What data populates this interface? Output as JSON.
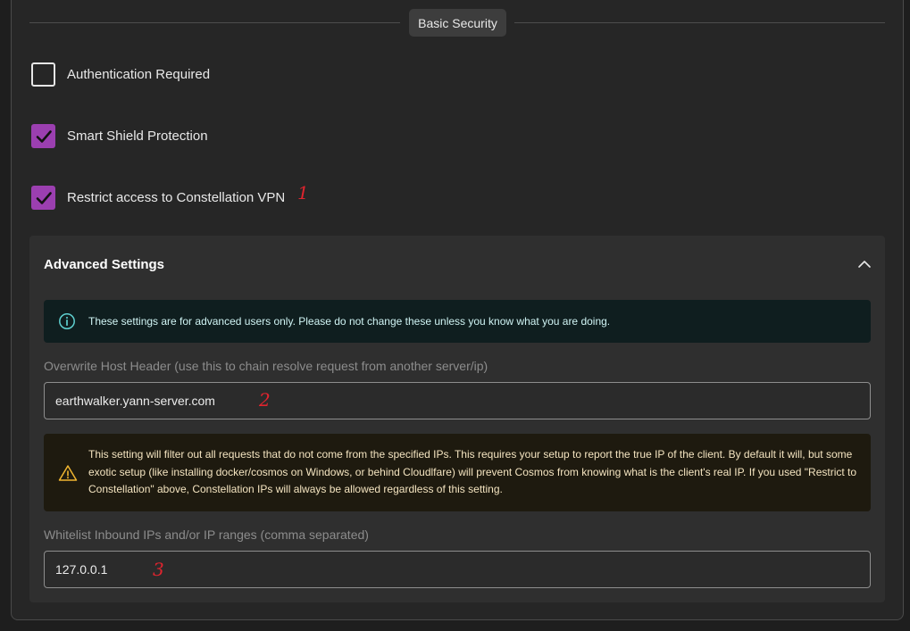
{
  "section": {
    "title": "Basic Security"
  },
  "checkboxes": [
    {
      "label": "Authentication Required",
      "checked": false
    },
    {
      "label": "Smart Shield Protection",
      "checked": true
    },
    {
      "label": "Restrict access to Constellation VPN",
      "checked": true
    }
  ],
  "annotations": [
    "1",
    "2",
    "3"
  ],
  "advanced": {
    "title": "Advanced Settings",
    "expanded": true,
    "info_text": "These settings are for advanced users only. Please do not change these unless you know what you are doing.",
    "host_header": {
      "label": "Overwrite Host Header (use this to chain resolve request from another server/ip)",
      "value": "earthwalker.yann-server.com"
    },
    "warning_text": "This setting will filter out all requests that do not come from the specified IPs. This requires your setup to report the true IP of the client. By default it will, but some exotic setup (like installing docker/cosmos on Windows, or behind Cloudlfare) will prevent Cosmos from knowing what is the client's real IP. If you used \"Restrict to Constellation\" above, Constellation IPs will always be allowed regardless of this setting.",
    "whitelist": {
      "label": "Whitelist Inbound IPs and/or IP ranges (comma separated)",
      "value": "127.0.0.1"
    }
  },
  "colors": {
    "accent": "#9b3fb0",
    "annotation": "#e0242e",
    "info": "#5fd0d0",
    "warning": "#f0b530"
  },
  "icons": {
    "info": "info-circle-icon",
    "warning": "warning-triangle-icon",
    "chevron": "chevron-up-icon",
    "check": "checkmark-icon"
  }
}
